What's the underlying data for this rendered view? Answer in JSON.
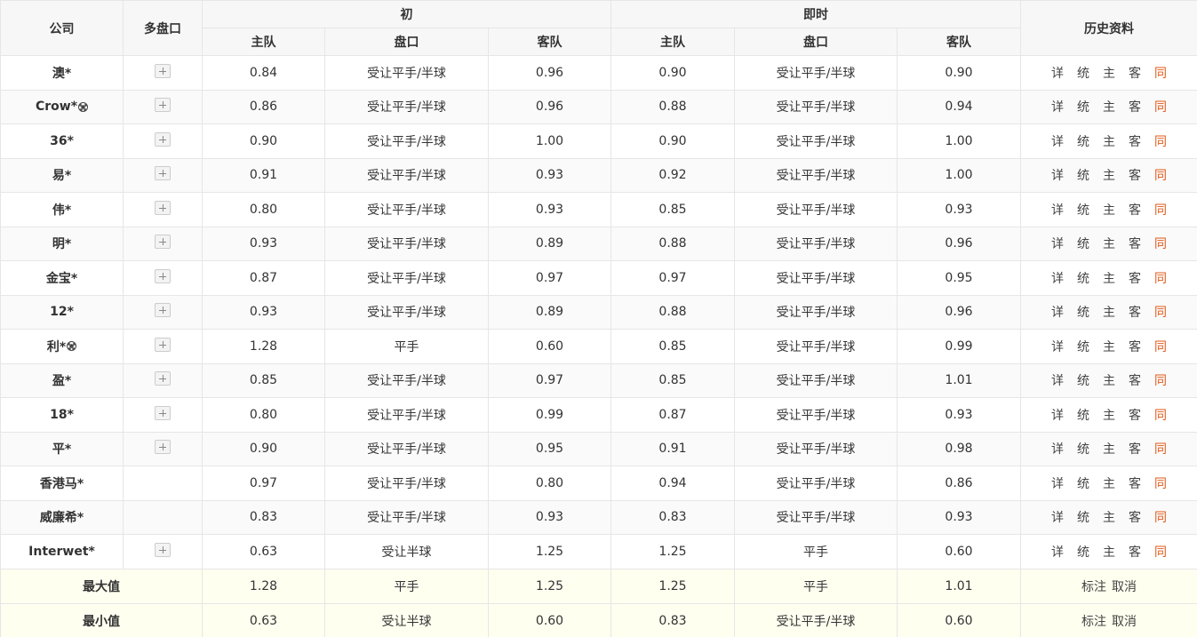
{
  "header": {
    "company": "公司",
    "multi": "多盘口",
    "initial": "初",
    "live": "即时",
    "history": "历史资料",
    "home": "主队",
    "handicap": "盘口",
    "away": "客队"
  },
  "history_links": [
    "详",
    "统",
    "主",
    "客",
    "同"
  ],
  "rows": [
    {
      "company": "澳*",
      "ball": false,
      "multi": true,
      "init_home": "0.84",
      "init_hcp": "受让平手/半球",
      "init_away": "0.96",
      "live_home": "0.90",
      "live_hcp": "受让平手/半球",
      "live_away": "0.90"
    },
    {
      "company": "Crow*",
      "ball": true,
      "multi": true,
      "init_home": "0.86",
      "init_hcp": "受让平手/半球",
      "init_away": "0.96",
      "live_home": "0.88",
      "live_hcp": "受让平手/半球",
      "live_away": "0.94"
    },
    {
      "company": "36*",
      "ball": false,
      "multi": true,
      "init_home": "0.90",
      "init_hcp": "受让平手/半球",
      "init_away": "1.00",
      "live_home": "0.90",
      "live_hcp": "受让平手/半球",
      "live_away": "1.00"
    },
    {
      "company": "易*",
      "ball": false,
      "multi": true,
      "init_home": "0.91",
      "init_hcp": "受让平手/半球",
      "init_away": "0.93",
      "live_home": "0.92",
      "live_hcp": "受让平手/半球",
      "live_away": "1.00"
    },
    {
      "company": "伟*",
      "ball": false,
      "multi": true,
      "init_home": "0.80",
      "init_hcp": "受让平手/半球",
      "init_away": "0.93",
      "live_home": "0.85",
      "live_hcp": "受让平手/半球",
      "live_away": "0.93"
    },
    {
      "company": "明*",
      "ball": false,
      "multi": true,
      "init_home": "0.93",
      "init_hcp": "受让平手/半球",
      "init_away": "0.89",
      "live_home": "0.88",
      "live_hcp": "受让平手/半球",
      "live_away": "0.96"
    },
    {
      "company": "金宝*",
      "ball": false,
      "multi": true,
      "init_home": "0.87",
      "init_hcp": "受让平手/半球",
      "init_away": "0.97",
      "live_home": "0.97",
      "live_hcp": "受让平手/半球",
      "live_away": "0.95"
    },
    {
      "company": "12*",
      "ball": false,
      "multi": true,
      "init_home": "0.93",
      "init_hcp": "受让平手/半球",
      "init_away": "0.89",
      "live_home": "0.88",
      "live_hcp": "受让平手/半球",
      "live_away": "0.96"
    },
    {
      "company": "利*",
      "ball": true,
      "multi": true,
      "init_home": "1.28",
      "init_hcp": "平手",
      "init_away": "0.60",
      "live_home": "0.85",
      "live_hcp": "受让平手/半球",
      "live_away": "0.99"
    },
    {
      "company": "盈*",
      "ball": false,
      "multi": true,
      "init_home": "0.85",
      "init_hcp": "受让平手/半球",
      "init_away": "0.97",
      "live_home": "0.85",
      "live_hcp": "受让平手/半球",
      "live_away": "1.01"
    },
    {
      "company": "18*",
      "ball": false,
      "multi": true,
      "init_home": "0.80",
      "init_hcp": "受让平手/半球",
      "init_away": "0.99",
      "live_home": "0.87",
      "live_hcp": "受让平手/半球",
      "live_away": "0.93"
    },
    {
      "company": "平*",
      "ball": false,
      "multi": true,
      "init_home": "0.90",
      "init_hcp": "受让平手/半球",
      "init_away": "0.95",
      "live_home": "0.91",
      "live_hcp": "受让平手/半球",
      "live_away": "0.98"
    },
    {
      "company": "香港马*",
      "ball": false,
      "multi": false,
      "init_home": "0.97",
      "init_hcp": "受让平手/半球",
      "init_away": "0.80",
      "live_home": "0.94",
      "live_hcp": "受让平手/半球",
      "live_away": "0.86"
    },
    {
      "company": "威廉希*",
      "ball": false,
      "multi": false,
      "init_home": "0.83",
      "init_hcp": "受让平手/半球",
      "init_away": "0.93",
      "live_home": "0.83",
      "live_hcp": "受让平手/半球",
      "live_away": "0.93"
    },
    {
      "company": "Interwet*",
      "ball": false,
      "multi": true,
      "init_home": "0.63",
      "init_hcp": "受让半球",
      "init_away": "1.25",
      "live_home": "1.25",
      "live_hcp": "平手",
      "live_away": "0.60"
    }
  ],
  "summary": [
    {
      "label": "最大值",
      "init_home": "1.28",
      "init_hcp": "平手",
      "init_away": "1.25",
      "live_home": "1.25",
      "live_hcp": "平手",
      "live_away": "1.01",
      "mark": "标注",
      "cancel": "取消"
    },
    {
      "label": "最小值",
      "init_home": "0.63",
      "init_hcp": "受让半球",
      "init_away": "0.60",
      "live_home": "0.83",
      "live_hcp": "受让平手/半球",
      "live_away": "0.60",
      "mark": "标注",
      "cancel": "取消"
    }
  ],
  "icons": {
    "expand": "plus-box-icon",
    "ball": "soccer-ball-icon"
  },
  "colors": {
    "same_link": "#e05a1a",
    "summary_bg": "#fffff0",
    "header_bg": "#f7f7f7"
  }
}
